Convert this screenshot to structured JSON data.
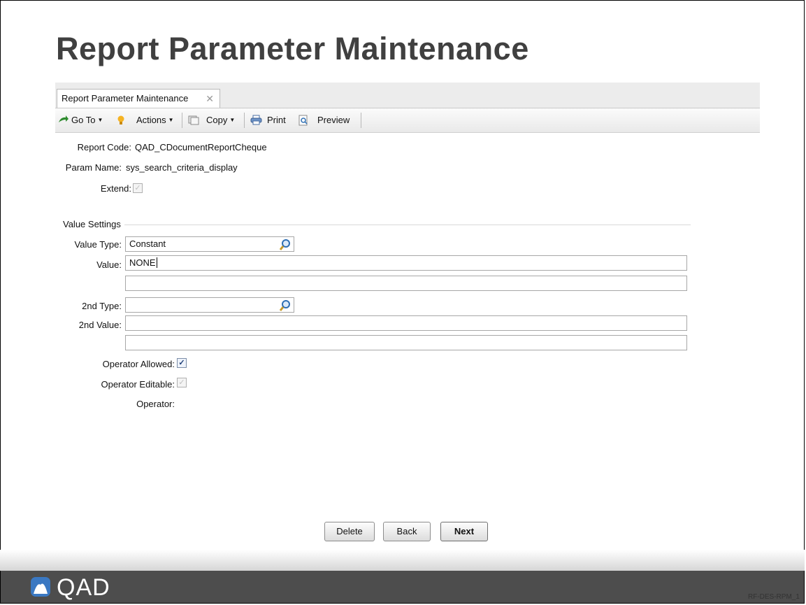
{
  "slide": {
    "title": "Report Parameter Maintenance",
    "code": "RF-DES-RPM_1"
  },
  "tab": {
    "label": "Report Parameter Maintenance",
    "close": "✕"
  },
  "toolbar": {
    "goto": "Go To",
    "actions": "Actions",
    "copy": "Copy",
    "print": "Print",
    "preview": "Preview"
  },
  "form": {
    "report_code_label": "Report Code:",
    "report_code_value": "QAD_CDocumentReportCheque",
    "param_name_label": "Param Name:",
    "param_name_value": "sys_search_criteria_display",
    "extend_label": "Extend:",
    "extend_checked": true,
    "section_title": "Value Settings",
    "value_type_label": "Value Type:",
    "value_type_value": "Constant",
    "value_label": "Value:",
    "value_value": "NONE",
    "value_extra": "",
    "second_type_label": "2nd Type:",
    "second_type_value": "",
    "second_value_label": "2nd Value:",
    "second_value_value": "",
    "second_value_extra": "",
    "operator_allowed_label": "Operator Allowed:",
    "operator_allowed_checked": true,
    "operator_editable_label": "Operator Editable:",
    "operator_editable_checked": true,
    "operator_label": "Operator:"
  },
  "buttons": {
    "delete": "Delete",
    "back": "Back",
    "next": "Next"
  },
  "footer": {
    "brand": "QAD"
  },
  "colors": {
    "footer_bg": "#4d4d4d",
    "title": "#404040",
    "accent_blue": "#2f6fb3"
  }
}
